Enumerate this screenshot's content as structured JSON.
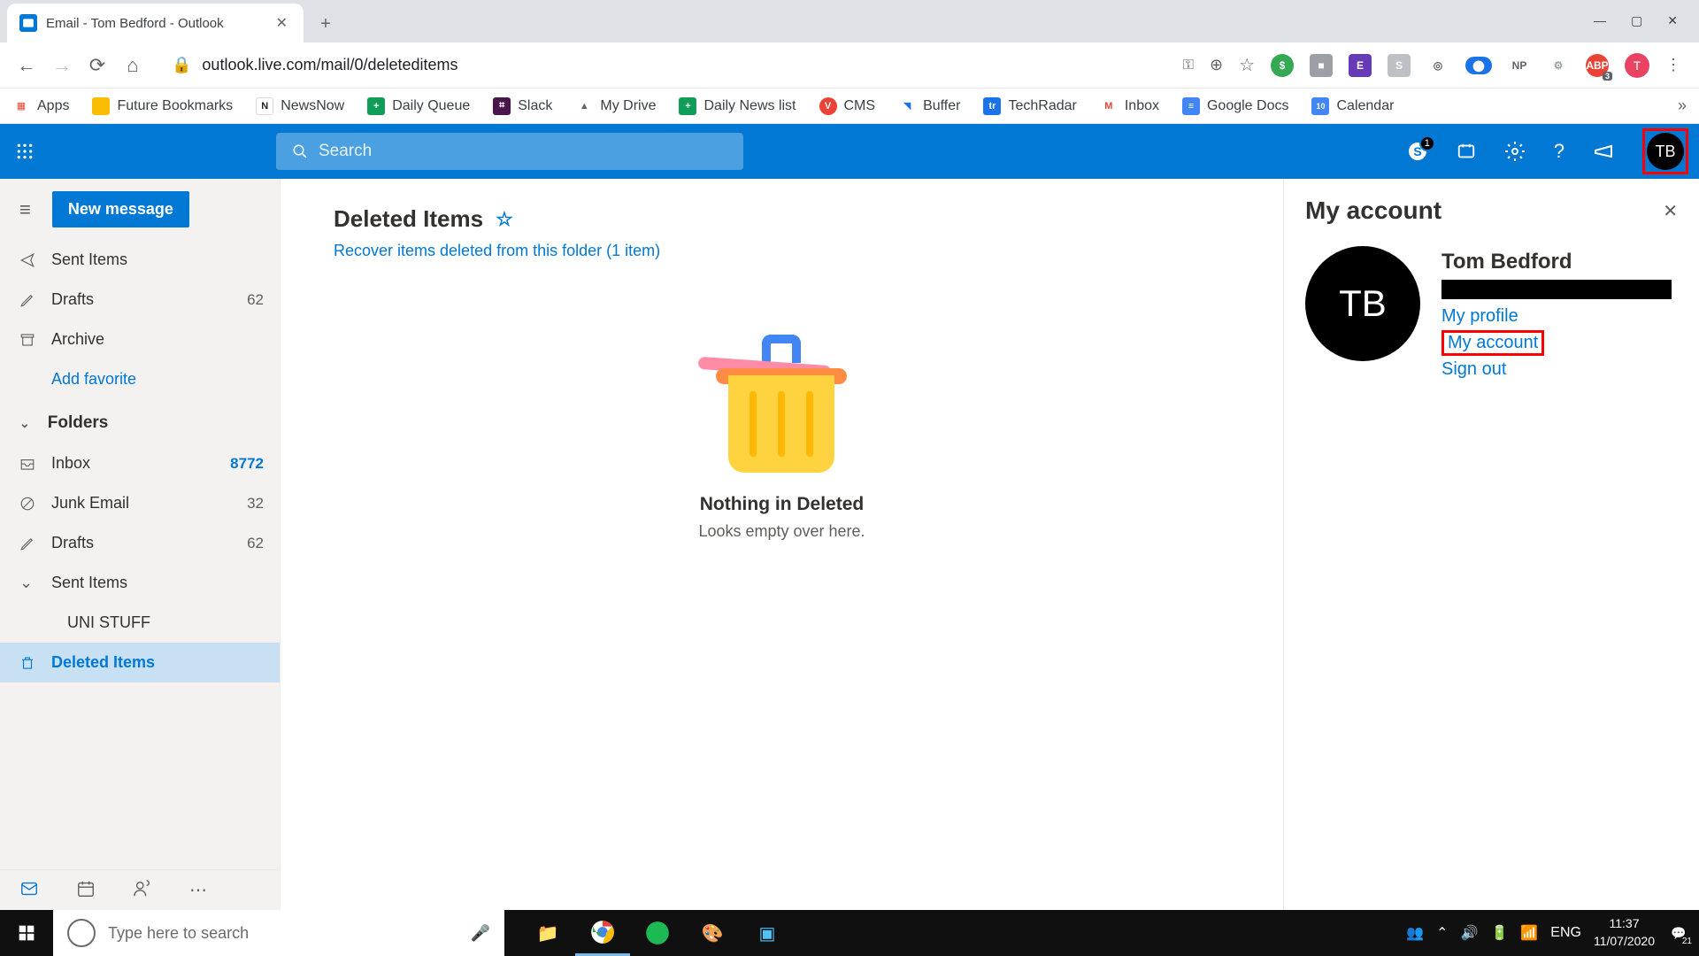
{
  "browser": {
    "tab_title": "Email - Tom Bedford - Outlook",
    "url": "outlook.live.com/mail/0/deleteditems",
    "abp_badge": "3",
    "avatar_letter": "T",
    "bookmarks": [
      "Apps",
      "Future Bookmarks",
      "NewsNow",
      "Daily Queue",
      "Slack",
      "My Drive",
      "Daily News list",
      "CMS",
      "Buffer",
      "TechRadar",
      "Inbox",
      "Google Docs",
      "Calendar"
    ]
  },
  "outlook": {
    "search_placeholder": "Search",
    "skype_badge": "1",
    "avatar_initials": "TB",
    "new_message": "New message",
    "fav_items": [
      {
        "icon": "send",
        "name": "Sent Items",
        "count": ""
      },
      {
        "icon": "draft",
        "name": "Drafts",
        "count": "62"
      },
      {
        "icon": "archive",
        "name": "Archive",
        "count": ""
      }
    ],
    "add_favorite": "Add favorite",
    "folders_label": "Folders",
    "folders": [
      {
        "icon": "inbox",
        "name": "Inbox",
        "count": "8772",
        "accent": true
      },
      {
        "icon": "junk",
        "name": "Junk Email",
        "count": "32"
      },
      {
        "icon": "draft",
        "name": "Drafts",
        "count": "62"
      },
      {
        "icon": "chevron",
        "name": "Sent Items",
        "count": ""
      },
      {
        "icon": "none",
        "name": "UNI STUFF",
        "count": "",
        "sub": true
      },
      {
        "icon": "trash",
        "name": "Deleted Items",
        "count": "",
        "selected": true
      }
    ],
    "main": {
      "title": "Deleted Items",
      "recover": "Recover items deleted from this folder (1 item)",
      "empty_title": "Nothing in Deleted",
      "empty_sub": "Looks empty over here."
    },
    "panel": {
      "title": "My account",
      "user_name": "Tom Bedford",
      "avatar_initials": "TB",
      "links": {
        "profile": "My profile",
        "account": "My account",
        "signout": "Sign out"
      }
    }
  },
  "taskbar": {
    "search_placeholder": "Type here to search",
    "lang": "ENG",
    "time": "11:37",
    "date": "11/07/2020",
    "notif_count": "21"
  }
}
